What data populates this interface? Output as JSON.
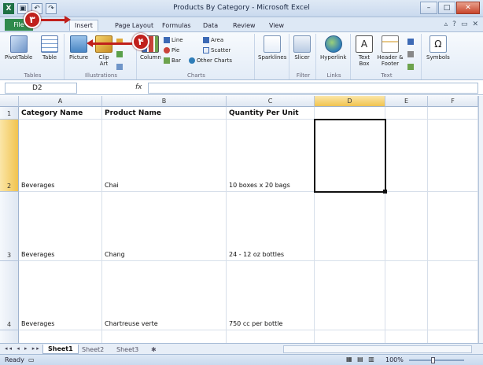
{
  "window": {
    "title": "Products By Category - Microsoft Excel",
    "minimize": "–",
    "maximize": "□",
    "close": "✕"
  },
  "ribbon_tabs": [
    "File",
    "Insert",
    "Page Layout",
    "Formulas",
    "Data",
    "Review",
    "View"
  ],
  "active_tab": "Insert",
  "ribbon": {
    "tables": {
      "label": "Tables",
      "pivot": "PivotTable",
      "table": "Table"
    },
    "illustrations": {
      "label": "Illustrations",
      "picture": "Picture",
      "clip": "Clip Art"
    },
    "charts": {
      "label": "Charts",
      "column": "Column",
      "line": "Line",
      "pie": "Pie",
      "bar": "Bar",
      "area": "Area",
      "scatter": "Scatter",
      "other": "Other Charts"
    },
    "sparklines": {
      "label": "Sparklines"
    },
    "filter": {
      "label": "Filter",
      "slicer": "Slicer"
    },
    "links": {
      "label": "Links",
      "hyperlink": "Hyperlink"
    },
    "text": {
      "label": "Text",
      "textbox": "Text Box",
      "header": "Header & Footer"
    },
    "symbols": {
      "label": "Symbols"
    }
  },
  "formula_bar": {
    "name_box": "D2",
    "fx": "fx",
    "value": ""
  },
  "columns": [
    "A",
    "B",
    "C",
    "D",
    "E",
    "F"
  ],
  "selected_column": "D",
  "rows": [
    {
      "num": "1",
      "a": "Category Name",
      "b": "Product Name",
      "c": "Quantity Per Unit"
    },
    {
      "num": "2",
      "a": "Beverages",
      "b": "Chai",
      "c": "10 boxes x 20 bags"
    },
    {
      "num": "3",
      "a": "Beverages",
      "b": "Chang",
      "c": "24 - 12 oz bottles"
    },
    {
      "num": "4",
      "a": "Beverages",
      "b": "Chartreuse verte",
      "c": "750 cc per bottle"
    }
  ],
  "sheets": [
    "Sheet1",
    "Sheet2",
    "Sheet3"
  ],
  "active_sheet": "Sheet1",
  "status": {
    "ready": "Ready",
    "zoom": "100%"
  },
  "callouts": {
    "step3": "٣",
    "step4": "۴"
  },
  "accent": "#c0201c"
}
